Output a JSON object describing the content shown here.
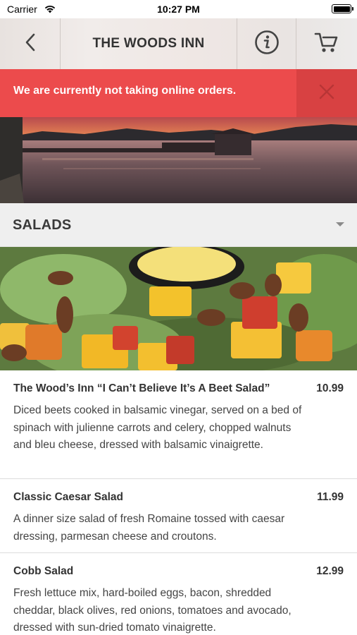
{
  "status_bar": {
    "carrier": "Carrier",
    "time": "10:27 PM"
  },
  "nav": {
    "title": "THE WOODS INN",
    "icons": {
      "back": "chevron-left-icon",
      "info": "info-circle-icon",
      "cart": "shopping-cart-icon"
    }
  },
  "banner": {
    "message": "We are currently not taking online orders.",
    "close_icon": "close-icon"
  },
  "category": {
    "title": "SALADS",
    "caret_icon": "caret-down-icon"
  },
  "menu_items": [
    {
      "name": "The Wood’s Inn “I Can’t Believe It’s A Beet Salad”",
      "price": "10.99",
      "description": "Diced beets cooked in balsamic vinegar, served on a bed of spinach with julienne carrots and celery, chopped walnuts and bleu cheese, dressed with balsamic vinaigrette."
    },
    {
      "name": "Classic Caesar Salad",
      "price": "11.99",
      "description": "A dinner size salad of fresh Romaine tossed with caesar dressing, parmesan cheese and croutons."
    },
    {
      "name": "Cobb Salad",
      "price": "12.99",
      "description": "Fresh lettuce mix, hard-boiled eggs, bacon, shredded cheddar, black olives, red onions, tomatoes and avocado, dressed with sun-dried tomato vinaigrette."
    }
  ],
  "colors": {
    "banner": "#ec4b4c",
    "banner_close_bg": "#d84142",
    "category_bg": "#efefef"
  }
}
